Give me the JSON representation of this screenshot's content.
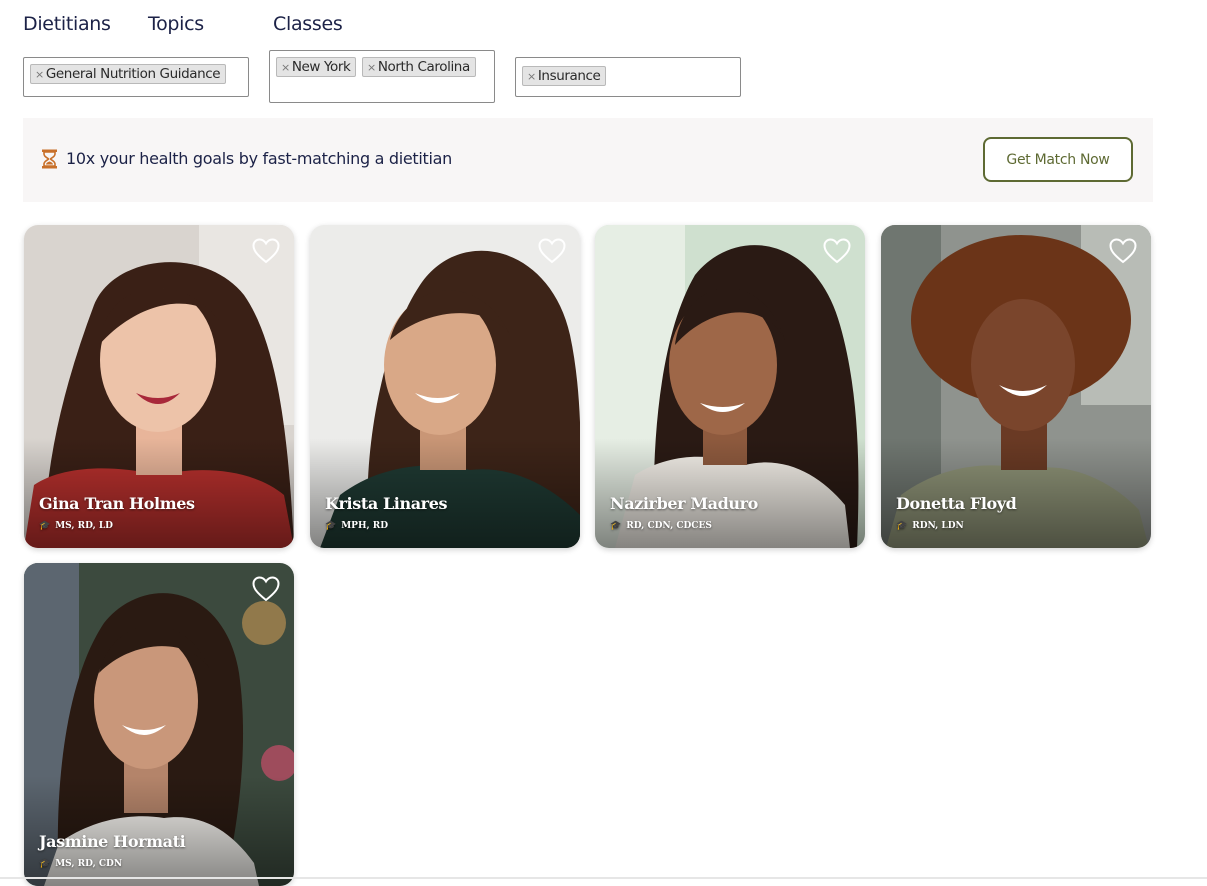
{
  "nav": {
    "dietitians": "Dietitians",
    "topics": "Topics",
    "classes": "Classes"
  },
  "filters": {
    "topics": [
      "General Nutrition Guidance"
    ],
    "locations": [
      "New York",
      "North Carolina"
    ],
    "payment": [
      "Insurance"
    ]
  },
  "banner": {
    "text": "10x your health goals by fast-matching a dietitian",
    "cta_label": "Get Match Now",
    "icon": "hourglass-icon"
  },
  "cards": [
    {
      "name": "Gina Tran Holmes",
      "credentials": "MS, RD, LD"
    },
    {
      "name": "Krista Linares",
      "credentials": "MPH, RD"
    },
    {
      "name": "Nazirber Maduro",
      "credentials": "RD, CDN, CDCES"
    },
    {
      "name": "Donetta Floyd",
      "credentials": "RDN, LDN"
    },
    {
      "name": "Jasmine Hormati",
      "credentials": "MS, RD, CDN"
    }
  ],
  "icons": {
    "favorite": "heart-outline-icon",
    "credentials": "graduation-cap-icon",
    "remove_chip": "close-icon"
  },
  "colors": {
    "navy": "#1c2247",
    "olive": "#5e6a33",
    "hourglass": "#c8702a",
    "banner_bg": "#f8f6f6"
  }
}
